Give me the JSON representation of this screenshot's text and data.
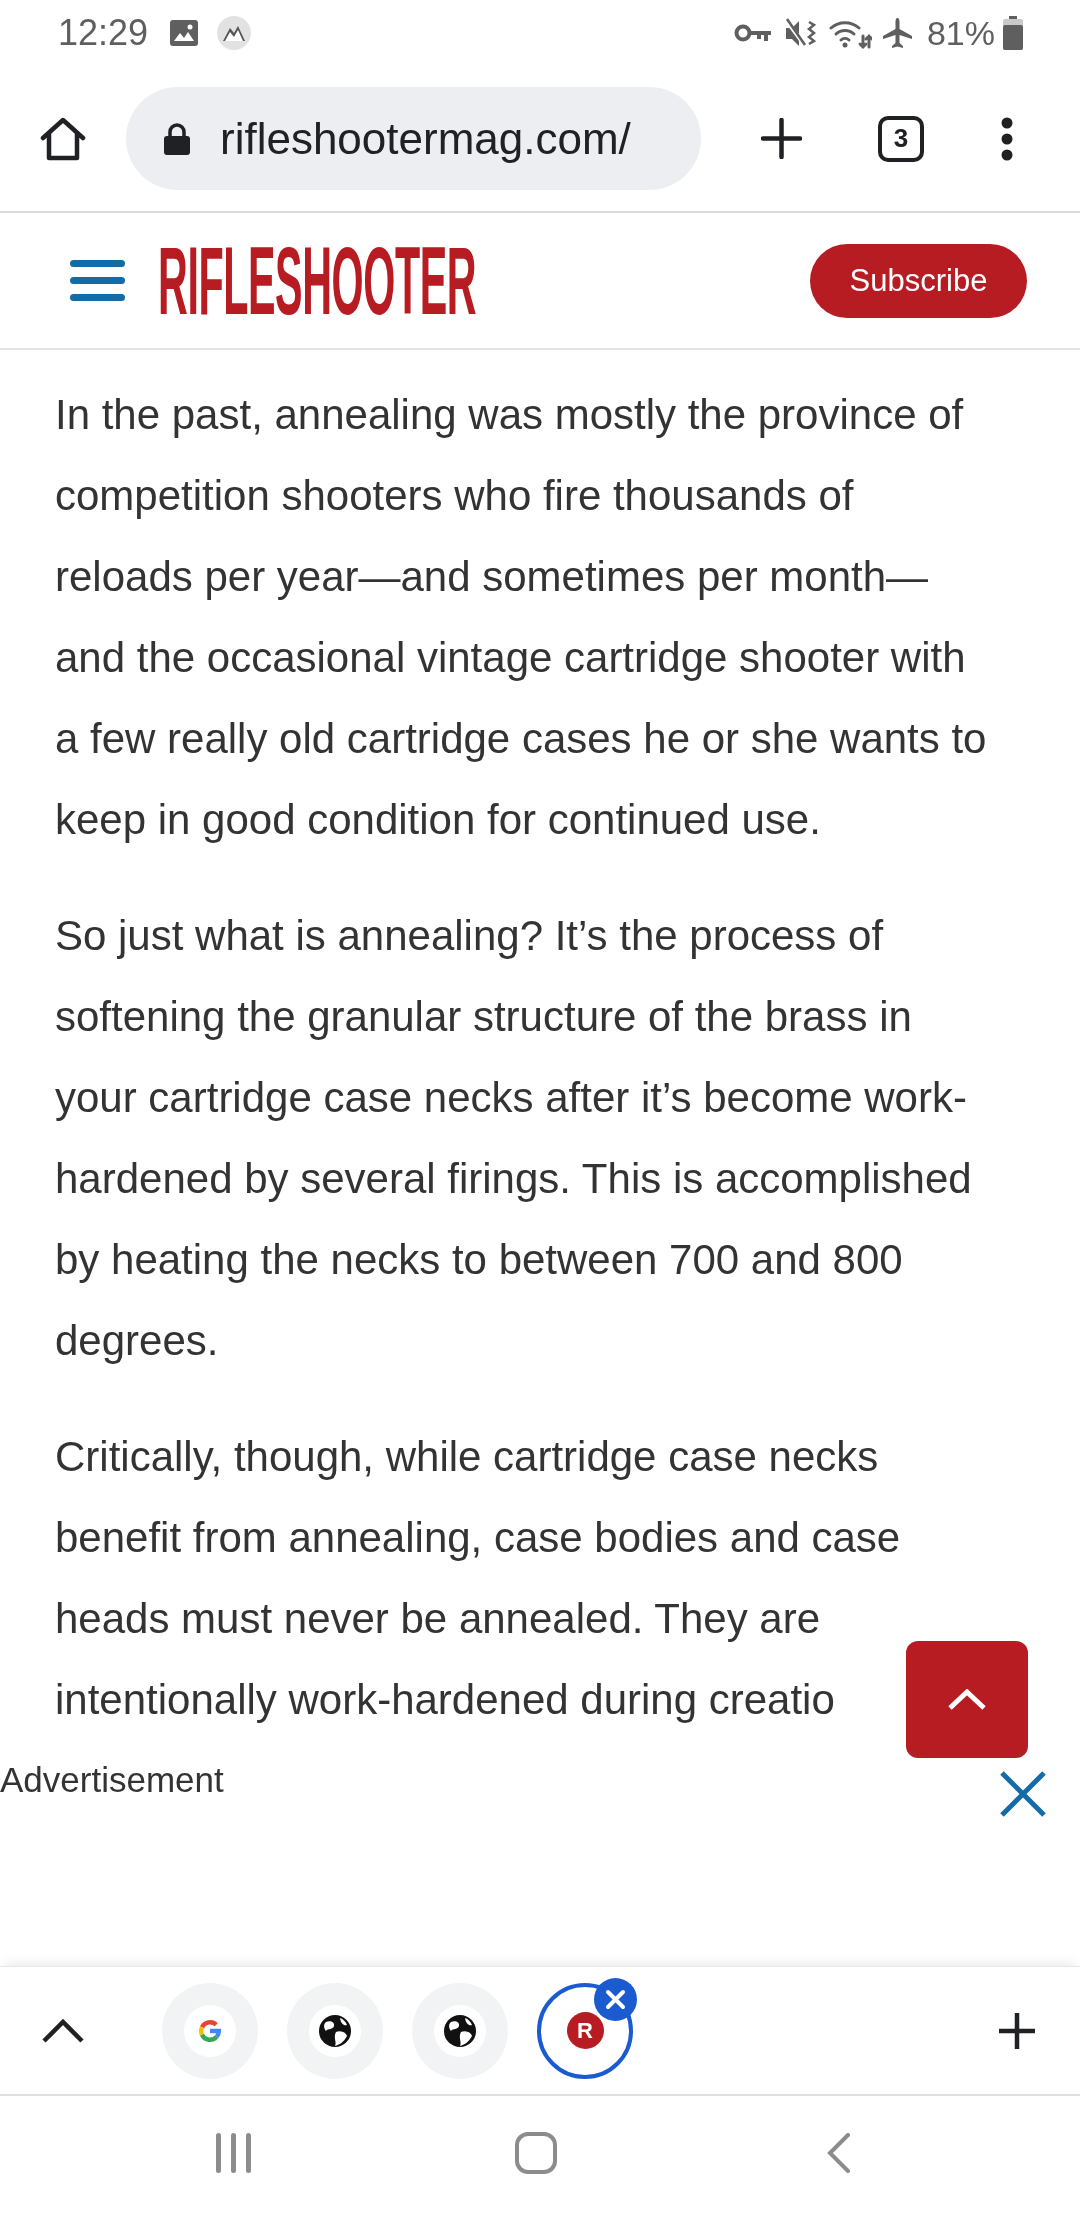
{
  "status_bar": {
    "time": "12:29",
    "battery_percent": "81%"
  },
  "browser_toolbar": {
    "url": "rifleshootermag.com/",
    "tab_count": "3"
  },
  "site_header": {
    "logo": "RIFLESHOOTER",
    "subscribe_button": "Subscribe"
  },
  "article": {
    "paragraphs": [
      "In the past, annealing was mostly the province of\ncompetition shooters who fire thousands of\nreloads per year—and sometimes per month—\nand the occasional vintage cartridge shooter with\na few really old cartridge cases he or she wants to\nkeep in good condition for continued use.",
      "So just what is annealing? It’s the process of\nsoftening the granular structure of the brass in\nyour cartridge case necks after it’s become work-hardened by several firings. This is accomplished\nby heating the necks to between 700 and 800\ndegrees.",
      "Critically, though, while cartridge case necks\nbenefit from annealing, case bodies and case\nheads must never be annealed. They are\nintentionally work-hardened during creatio"
    ]
  },
  "advertisement": {
    "label": "Advertisement"
  },
  "tab_strip": {
    "tabs": [
      {
        "kind": "g-logo",
        "selected": false
      },
      {
        "kind": "globe",
        "selected": false
      },
      {
        "kind": "globe",
        "selected": false
      },
      {
        "kind": "letter",
        "text": "R",
        "selected": true
      }
    ]
  }
}
